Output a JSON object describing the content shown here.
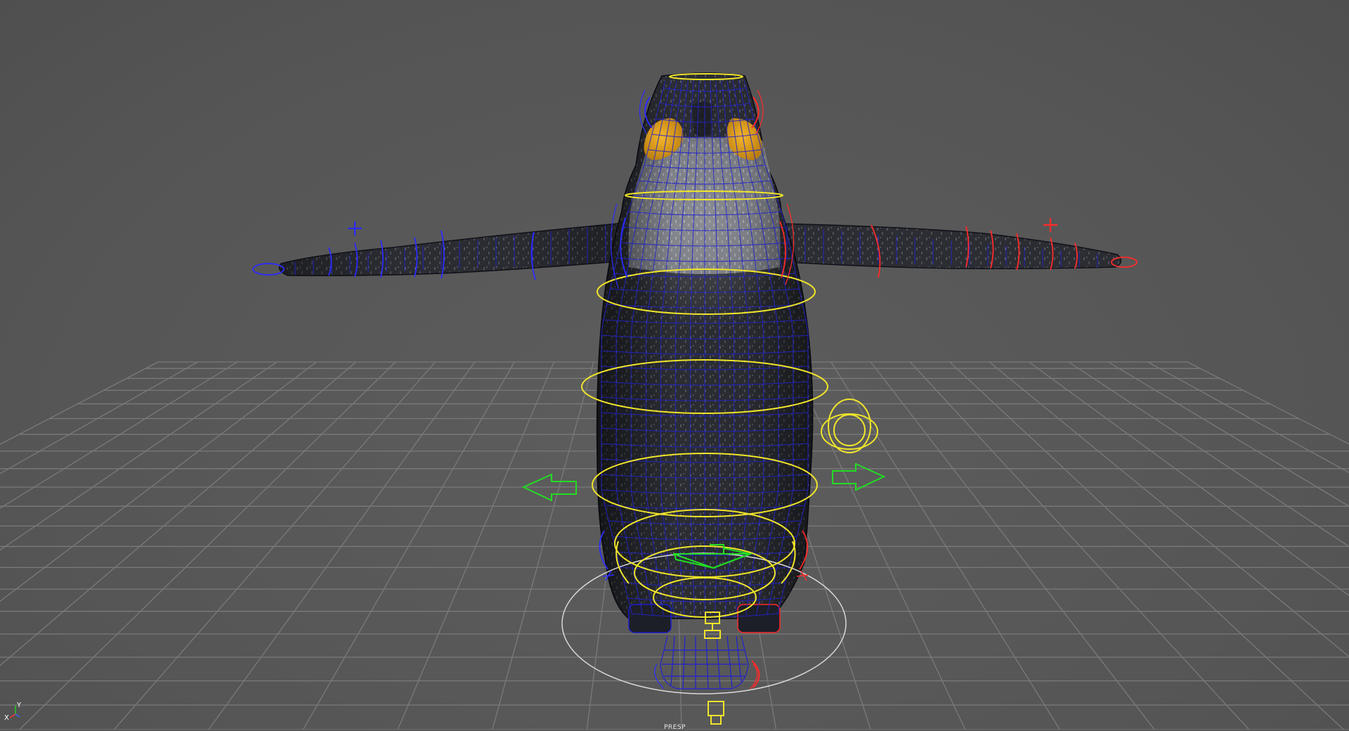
{
  "viewport": {
    "camera_name": "PRESP",
    "axis_gizmo": {
      "y_label": "Y",
      "x_label": "X"
    }
  },
  "colors": {
    "background": "#575757",
    "grid": "#7a7a7a",
    "mesh_body": "#2b2d33",
    "wireframe": "#1b1cc8",
    "ctrl_center": "#f0e52a",
    "ctrl_left": "#2b2bff",
    "ctrl_right": "#ff2a2a",
    "ctrl_ik": "#22dd22",
    "ctrl_root": "#d8d8d8",
    "eye": "#e1a21b"
  }
}
